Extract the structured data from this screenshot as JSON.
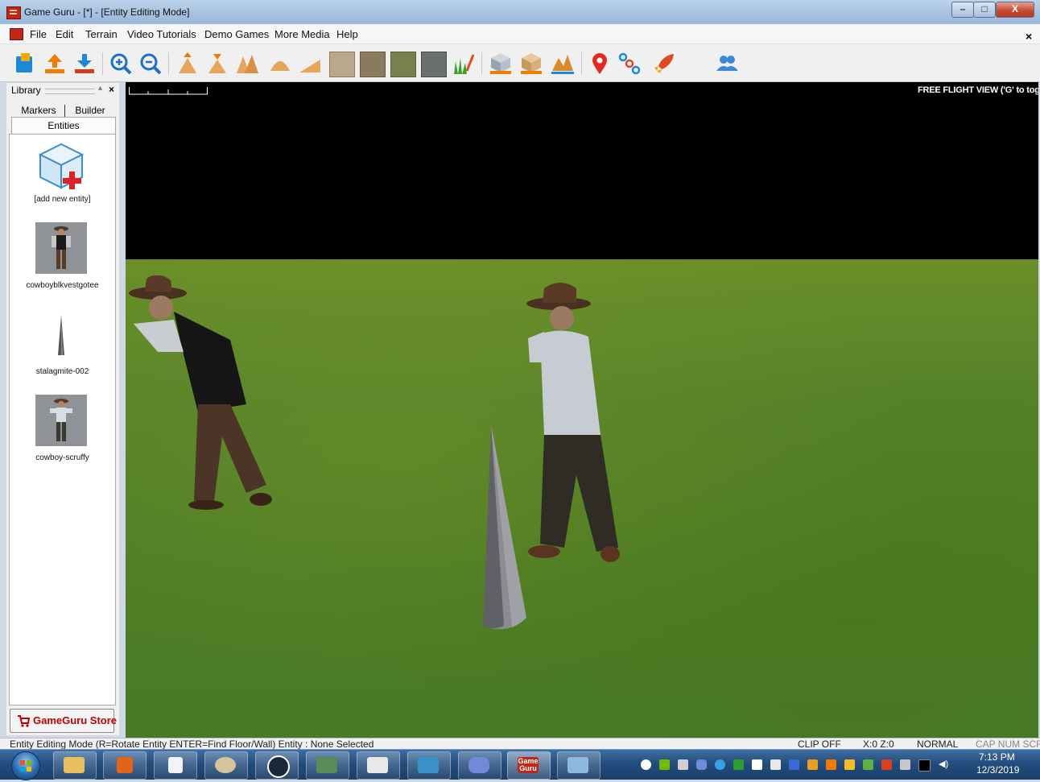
{
  "window": {
    "title": "Game Guru - [*] - [Entity Editing Mode]",
    "minimize_glyph": "–",
    "maximize_glyph": "□",
    "close_glyph": "X"
  },
  "menu": {
    "items": [
      "File",
      "Edit",
      "Terrain",
      "Video Tutorials",
      "Demo Games",
      "More Media",
      "Help"
    ],
    "close_glyph": "×"
  },
  "toolbar": {
    "icons": [
      "new-level-icon",
      "load-level-icon",
      "save-level-icon",
      "zoom-in-icon",
      "zoom-out-icon",
      "raise-terrain-icon",
      "lower-terrain-icon",
      "level-terrain-icon",
      "blend-terrain-icon",
      "ramp-terrain-icon",
      "paint-texture-1-icon",
      "paint-texture-2-icon",
      "paint-texture-3-icon",
      "paint-texture-4-icon",
      "paint-grass-icon",
      "entity-mode-icon",
      "static-entity-icon",
      "waypoint-icon",
      "marker-icon",
      "waypoint-nodes-icon",
      "test-game-icon",
      "multiplayer-icon"
    ]
  },
  "library": {
    "title": "Library",
    "pin_glyph": "▴",
    "close_glyph": "×",
    "tabs": [
      "Markers",
      "Builder"
    ],
    "active_tab": "Entities",
    "entities": [
      {
        "label": "[add new entity]",
        "icon": "add-entity-icon"
      },
      {
        "label": "cowboyblkvestgotee",
        "icon": "cowboy-black-vest-thumbnail"
      },
      {
        "label": "stalagmite-002",
        "icon": "stalagmite-thumbnail"
      },
      {
        "label": "cowboy-scruffy",
        "icon": "cowboy-scruffy-thumbnail"
      }
    ],
    "store_label": "GameGuru Store"
  },
  "viewport": {
    "view_mode": "FREE FLIGHT VIEW ('G' to toggle)"
  },
  "status": {
    "mode_help": "Entity Editing Mode (R=Rotate Entity  ENTER=Find Floor/Wall)  Entity : None Selected",
    "clip": "CLIP OFF",
    "coords": "X:0  Z:0",
    "speed": "NORMAL",
    "keys": "CAP NUM SCRL"
  },
  "taskbar": {
    "apps": [
      "file-explorer",
      "media-player",
      "notepad",
      "paint",
      "steam",
      "network-tool",
      "files",
      "photo-viewer",
      "discord",
      "gameguru",
      "control-panel"
    ],
    "gameguru_label": "Game Guru",
    "time": "7:13 PM",
    "date": "12/3/2019"
  },
  "colors": {
    "title_gradient": "#a9c3e1",
    "store_red": "#c00000",
    "grass": "#55822a",
    "sky": "#000000",
    "taskbar": "#244d7d"
  }
}
